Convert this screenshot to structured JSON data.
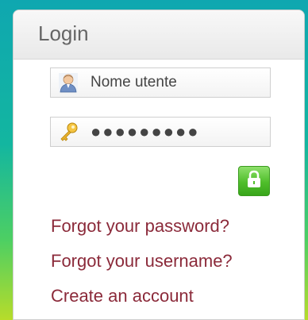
{
  "login": {
    "title": "Login",
    "username": {
      "value": "Nome utente",
      "icon": "user-icon"
    },
    "password": {
      "value": "●●●●●●●●●",
      "icon": "key-icon"
    },
    "submit": {
      "icon": "lock-icon",
      "color": "#4fbe2b"
    },
    "links": [
      {
        "label": "Forgot your password?"
      },
      {
        "label": "Forgot your username?"
      },
      {
        "label": "Create an account"
      }
    ],
    "link_color": "#8b2a3a"
  }
}
